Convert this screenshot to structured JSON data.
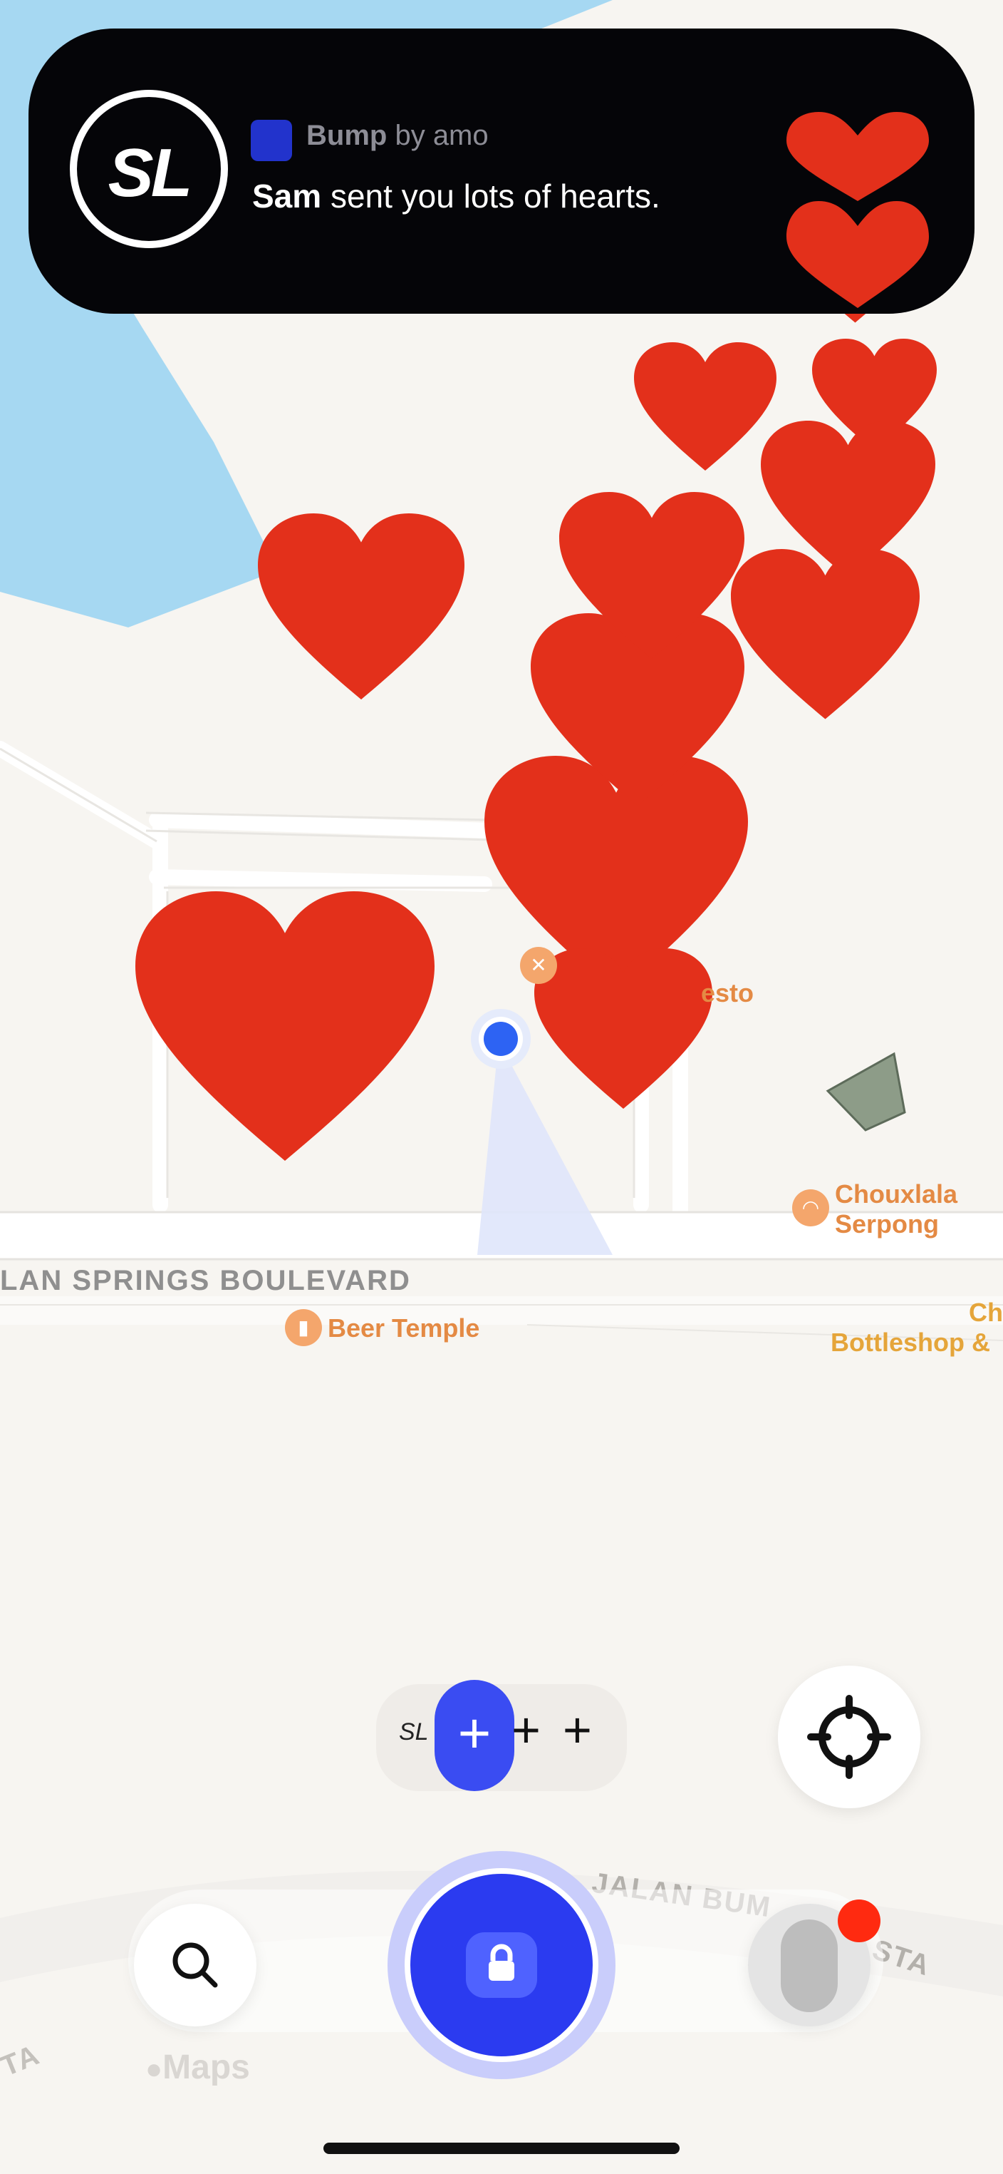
{
  "notification": {
    "avatar_initials": "SL",
    "app_name": "Bump",
    "app_by": "by amo",
    "sender": "Sam",
    "message": "sent you lots of hearts."
  },
  "map": {
    "road_label_1": "LAN SPRINGS BOULEVARD",
    "road_label_2": "JALAN BUM",
    "road_label_3": "STA",
    "road_label_4": "TA",
    "pois": [
      {
        "name": "esto",
        "icon": "fork-knife-icon"
      },
      {
        "name_line1": "Chouxlala",
        "name_line2": "Serpong",
        "icon": "croissant-icon"
      },
      {
        "name": "Beer Temple",
        "icon": "bottle-glass-icon"
      },
      {
        "name_line1": "Ch",
        "name_line2": "Bottleshop &",
        "icon": "bottle-icon"
      }
    ],
    "attribution": "Maps"
  },
  "friend_bar": {
    "initials": "SL"
  },
  "colors": {
    "heart": "#e8301a",
    "accent_blue": "#2b3bf0",
    "water": "#a6d8f2",
    "notification_bg": "#050508",
    "badge_red": "#ff2a10"
  }
}
